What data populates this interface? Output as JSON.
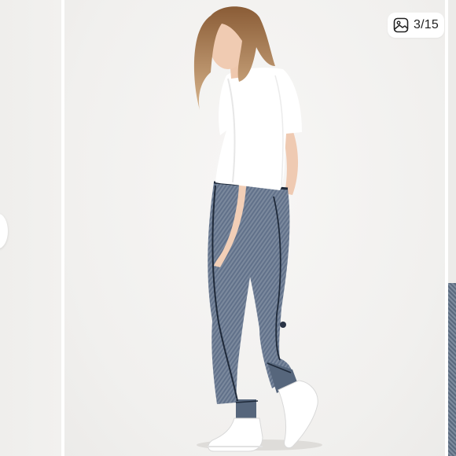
{
  "gallery": {
    "counter": "3/15",
    "counter_icon": "image-gallery-icon"
  },
  "colors": {
    "background": "#f3f2f0",
    "pants": "#5f6f85",
    "piping": "#1f2a3a",
    "shirt": "#ffffff",
    "hair": "#b98a5c"
  }
}
